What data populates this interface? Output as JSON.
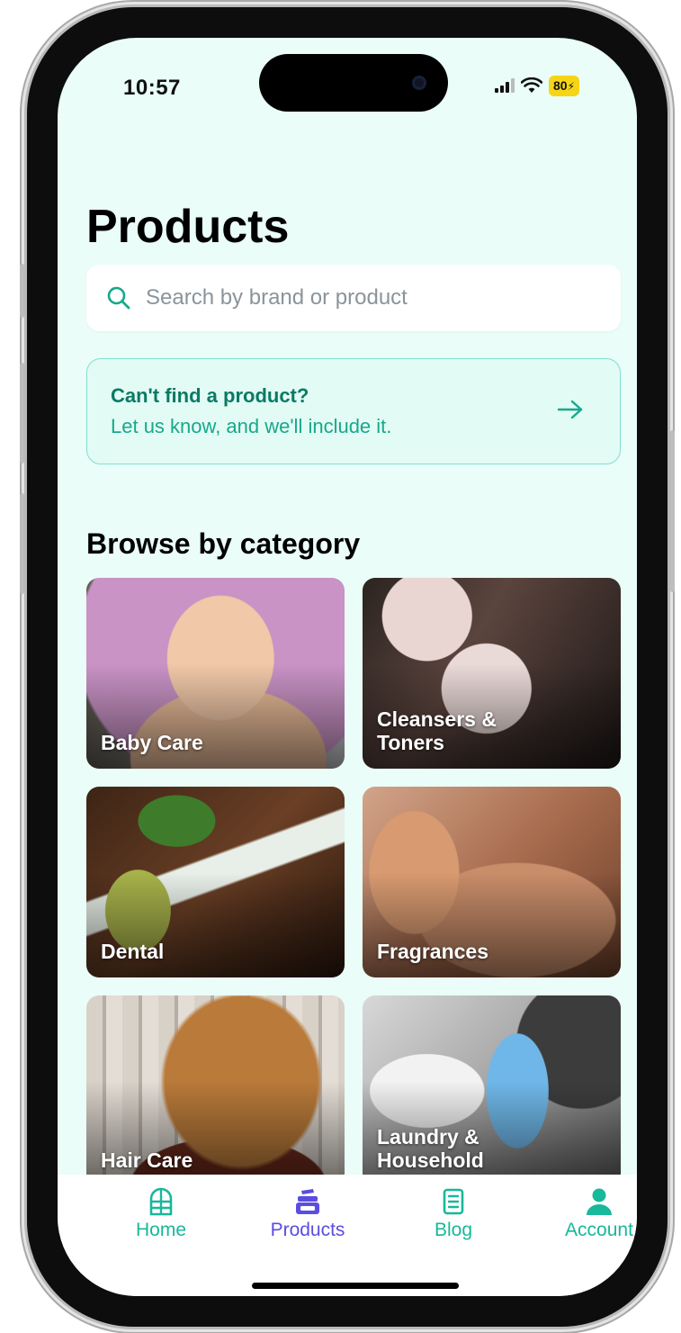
{
  "status_bar": {
    "time": "10:57",
    "battery": "80"
  },
  "page": {
    "title": "Products"
  },
  "search": {
    "placeholder": "Search by brand or product",
    "value": ""
  },
  "request_banner": {
    "title": "Can't find a product?",
    "subtitle": "Let us know, and we'll include it."
  },
  "browse": {
    "title": "Browse by category",
    "categories": [
      {
        "label": "Baby Care"
      },
      {
        "label": "Cleansers & Toners"
      },
      {
        "label": "Dental"
      },
      {
        "label": "Fragrances"
      },
      {
        "label": "Hair Care"
      },
      {
        "label": "Laundry & Household"
      }
    ]
  },
  "tab_bar": {
    "items": [
      {
        "label": "Home",
        "icon": "home-window-icon",
        "active": false
      },
      {
        "label": "Products",
        "icon": "products-jar-icon",
        "active": true
      },
      {
        "label": "Blog",
        "icon": "blog-document-icon",
        "active": false
      },
      {
        "label": "Account",
        "icon": "account-person-icon",
        "active": false
      }
    ]
  },
  "colors": {
    "background": "#eafdf8",
    "accent": "#18b89a",
    "accent_dark": "#0b7a64",
    "active_tab": "#5b4de0",
    "banner_border": "#7fe0cd"
  }
}
